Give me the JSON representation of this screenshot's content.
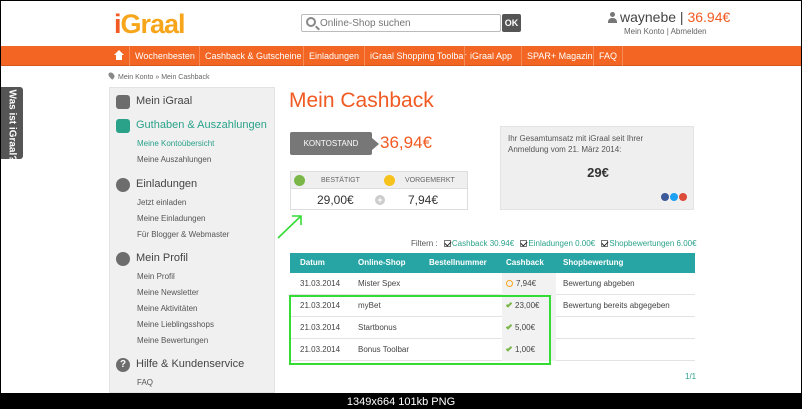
{
  "header": {
    "logo_i": "i",
    "logo_rest": "Graal",
    "search_placeholder": "Online-Shop suchen",
    "search_button": "OK",
    "username": "waynebe",
    "balance": "36.94€",
    "my_account": "Mein Konto",
    "separator": "|",
    "logout": "Abmelden"
  },
  "nav": {
    "items": [
      "Wochenbesten",
      "Cashback & Gutscheine",
      "Einladungen",
      "iGraal Shopping Toolbar",
      "iGraal App",
      "SPAR+ Magazin",
      "FAQ"
    ]
  },
  "breadcrumb": "Mein Konto » Mein Cashback",
  "side_tab": "Was ist iGraal?",
  "sidebar": {
    "sections": [
      {
        "title": "Mein iGraal",
        "items": []
      },
      {
        "title": "Guthaben & Auszahlungen",
        "items": [
          "Meine Kontoübersicht",
          "Meine Auszahlungen"
        ]
      },
      {
        "title": "Einladungen",
        "items": [
          "Jetzt einladen",
          "Meine Einladungen",
          "Für Blogger & Webmaster"
        ]
      },
      {
        "title": "Mein Profil",
        "items": [
          "Mein Profil",
          "Meine Newsletter",
          "Meine Aktivitäten",
          "Meine Lieblingsshops",
          "Meine Bewertungen"
        ]
      },
      {
        "title": "Hilfe & Kundenservice",
        "items": [
          "FAQ"
        ]
      }
    ]
  },
  "main": {
    "title": "Mein Cashback",
    "kontostand_label": "KONTOSTAND",
    "kontostand_value": "36,94€",
    "bestaetigt_label": "BESTÄTIGT",
    "bestaetigt_value": "29,00€",
    "vorgemerkt_label": "VORGEMERKT",
    "vorgemerkt_value": "7,94€",
    "plus": "+",
    "total_text": "Ihr Gesamtumsatz mit iGraal seit Ihrer Anmeldung vom 21. März 2014:",
    "total_value": "29€"
  },
  "filters": {
    "label": "Filtern :",
    "items": [
      "Cashback 30.94€",
      "Einladungen 0.00€",
      "Shopbewertungen 6.00€"
    ]
  },
  "table": {
    "headers": [
      "Datum",
      "Online-Shop",
      "Bestellnummer",
      "Cashback",
      "Shopbewertung"
    ],
    "rows": [
      {
        "date": "31.03.2014",
        "shop": "Mister Spex",
        "order": "",
        "cashback": "7,94€",
        "status": "pending",
        "rating": "Bewertung abgeben"
      },
      {
        "date": "21.03.2014",
        "shop": "myBet",
        "order": "",
        "cashback": "23,00€",
        "status": "confirmed",
        "rating": "Bewertung bereits abgegeben"
      },
      {
        "date": "21.03.2014",
        "shop": "Startbonus",
        "order": "",
        "cashback": "5,00€",
        "status": "confirmed",
        "rating": ""
      },
      {
        "date": "21.03.2014",
        "shop": "Bonus Toolbar",
        "order": "",
        "cashback": "1,00€",
        "status": "confirmed",
        "rating": ""
      }
    ],
    "pager": "1/1"
  },
  "colors": {
    "brand_orange": "#f26522",
    "accent_teal": "#27a4a4",
    "annotation_green": "#33dd33"
  },
  "caption": "1349x664 101kb PNG"
}
